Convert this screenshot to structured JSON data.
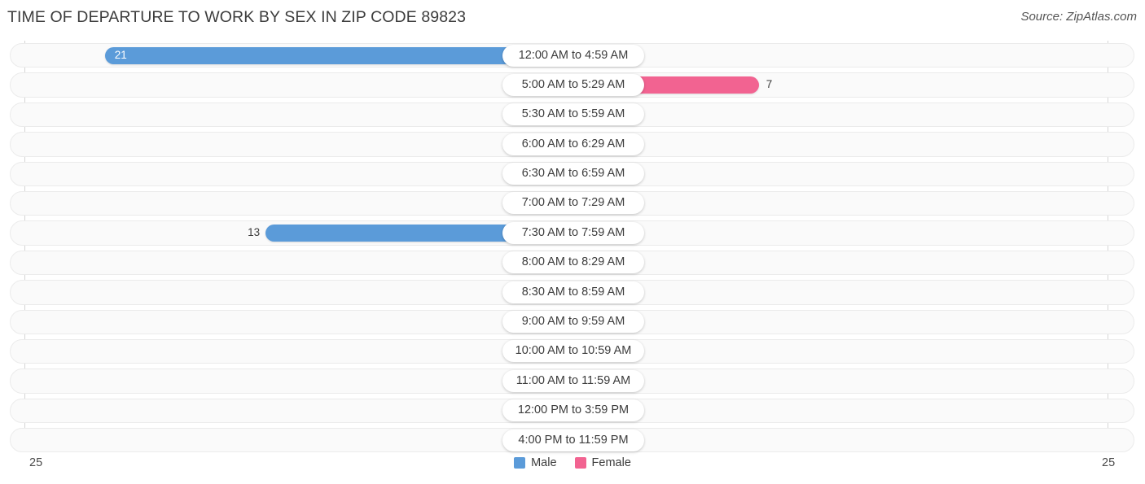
{
  "header": {
    "title": "TIME OF DEPARTURE TO WORK BY SEX IN ZIP CODE 89823",
    "source": "Source: ZipAtlas.com"
  },
  "legend": {
    "male_label": "Male",
    "female_label": "Female",
    "male_color": "#5b9bd9",
    "female_color": "#f26391"
  },
  "axis": {
    "left_label": "25",
    "right_label": "25"
  },
  "chart_data": {
    "type": "bar",
    "title": "TIME OF DEPARTURE TO WORK BY SEX IN ZIP CODE 89823",
    "subtitle": "Source: ZipAtlas.com",
    "orientation": "horizontal-diverging",
    "xlabel": "",
    "ylabel": "",
    "xlim": [
      25,
      25
    ],
    "grid": false,
    "legend_position": "bottom-center",
    "categories": [
      "12:00 AM to 4:59 AM",
      "5:00 AM to 5:29 AM",
      "5:30 AM to 5:59 AM",
      "6:00 AM to 6:29 AM",
      "6:30 AM to 6:59 AM",
      "7:00 AM to 7:29 AM",
      "7:30 AM to 7:59 AM",
      "8:00 AM to 8:29 AM",
      "8:30 AM to 8:59 AM",
      "9:00 AM to 9:59 AM",
      "10:00 AM to 10:59 AM",
      "11:00 AM to 11:59 AM",
      "12:00 PM to 3:59 PM",
      "4:00 PM to 11:59 PM"
    ],
    "series": [
      {
        "name": "Male",
        "color": "#5b9bd9",
        "values": [
          21,
          0,
          0,
          0,
          0,
          0,
          13,
          0,
          0,
          0,
          0,
          0,
          0,
          0
        ]
      },
      {
        "name": "Female",
        "color": "#f26391",
        "values": [
          0,
          7,
          0,
          0,
          0,
          0,
          0,
          0,
          0,
          0,
          0,
          0,
          0,
          0
        ]
      }
    ]
  },
  "rows": [
    {
      "label": "12:00 AM to 4:59 AM",
      "male": "21",
      "female": "0"
    },
    {
      "label": "5:00 AM to 5:29 AM",
      "male": "0",
      "female": "7"
    },
    {
      "label": "5:30 AM to 5:59 AM",
      "male": "0",
      "female": "0"
    },
    {
      "label": "6:00 AM to 6:29 AM",
      "male": "0",
      "female": "0"
    },
    {
      "label": "6:30 AM to 6:59 AM",
      "male": "0",
      "female": "0"
    },
    {
      "label": "7:00 AM to 7:29 AM",
      "male": "0",
      "female": "0"
    },
    {
      "label": "7:30 AM to 7:59 AM",
      "male": "13",
      "female": "0"
    },
    {
      "label": "8:00 AM to 8:29 AM",
      "male": "0",
      "female": "0"
    },
    {
      "label": "8:30 AM to 8:59 AM",
      "male": "0",
      "female": "0"
    },
    {
      "label": "9:00 AM to 9:59 AM",
      "male": "0",
      "female": "0"
    },
    {
      "label": "10:00 AM to 10:59 AM",
      "male": "0",
      "female": "0"
    },
    {
      "label": "11:00 AM to 11:59 AM",
      "male": "0",
      "female": "0"
    },
    {
      "label": "12:00 PM to 3:59 PM",
      "male": "0",
      "female": "0"
    },
    {
      "label": "4:00 PM to 11:59 PM",
      "male": "0",
      "female": "0"
    }
  ]
}
